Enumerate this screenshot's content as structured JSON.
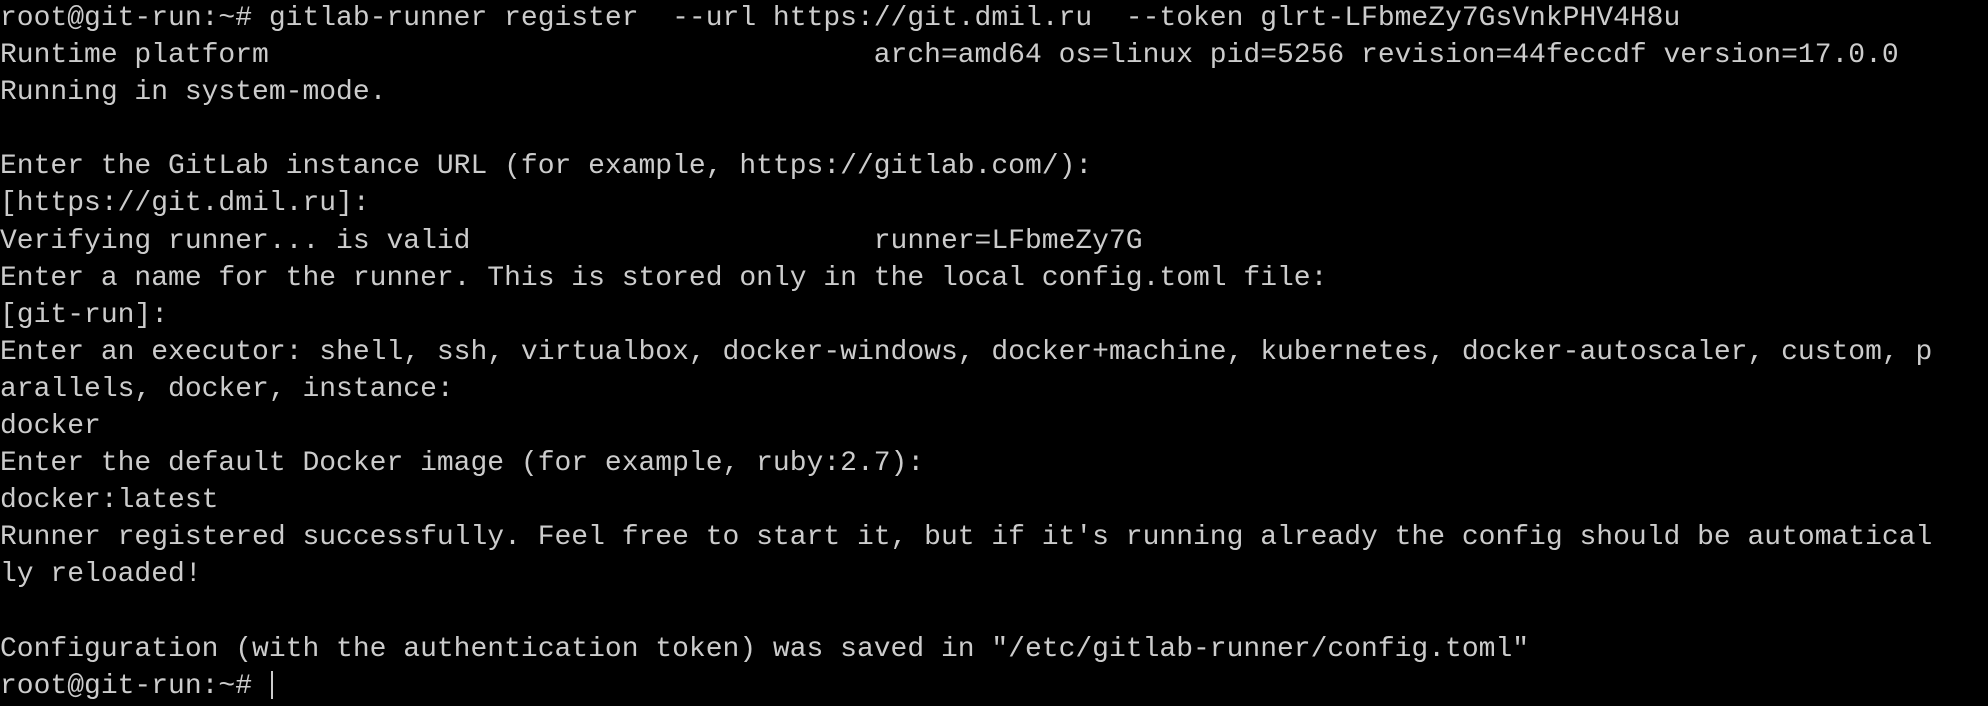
{
  "terminal": {
    "lines": [
      "root@git-run:~# gitlab-runner register  --url https://git.dmil.ru  --token glrt-LFbmeZy7GsVnkPHV4H8u",
      "Runtime platform                                    arch=amd64 os=linux pid=5256 revision=44feccdf version=17.0.0",
      "Running in system-mode.",
      "",
      "Enter the GitLab instance URL (for example, https://gitlab.com/):",
      "[https://git.dmil.ru]:",
      "Verifying runner... is valid                        runner=LFbmeZy7G",
      "Enter a name for the runner. This is stored only in the local config.toml file:",
      "[git-run]:",
      "Enter an executor: shell, ssh, virtualbox, docker-windows, docker+machine, kubernetes, docker-autoscaler, custom, p",
      "arallels, docker, instance:",
      "docker",
      "Enter the default Docker image (for example, ruby:2.7):",
      "docker:latest",
      "Runner registered successfully. Feel free to start it, but if it's running already the config should be automatical",
      "ly reloaded!",
      "",
      "Configuration (with the authentication token) was saved in \"/etc/gitlab-runner/config.toml\"",
      "root@git-run:~# "
    ]
  }
}
